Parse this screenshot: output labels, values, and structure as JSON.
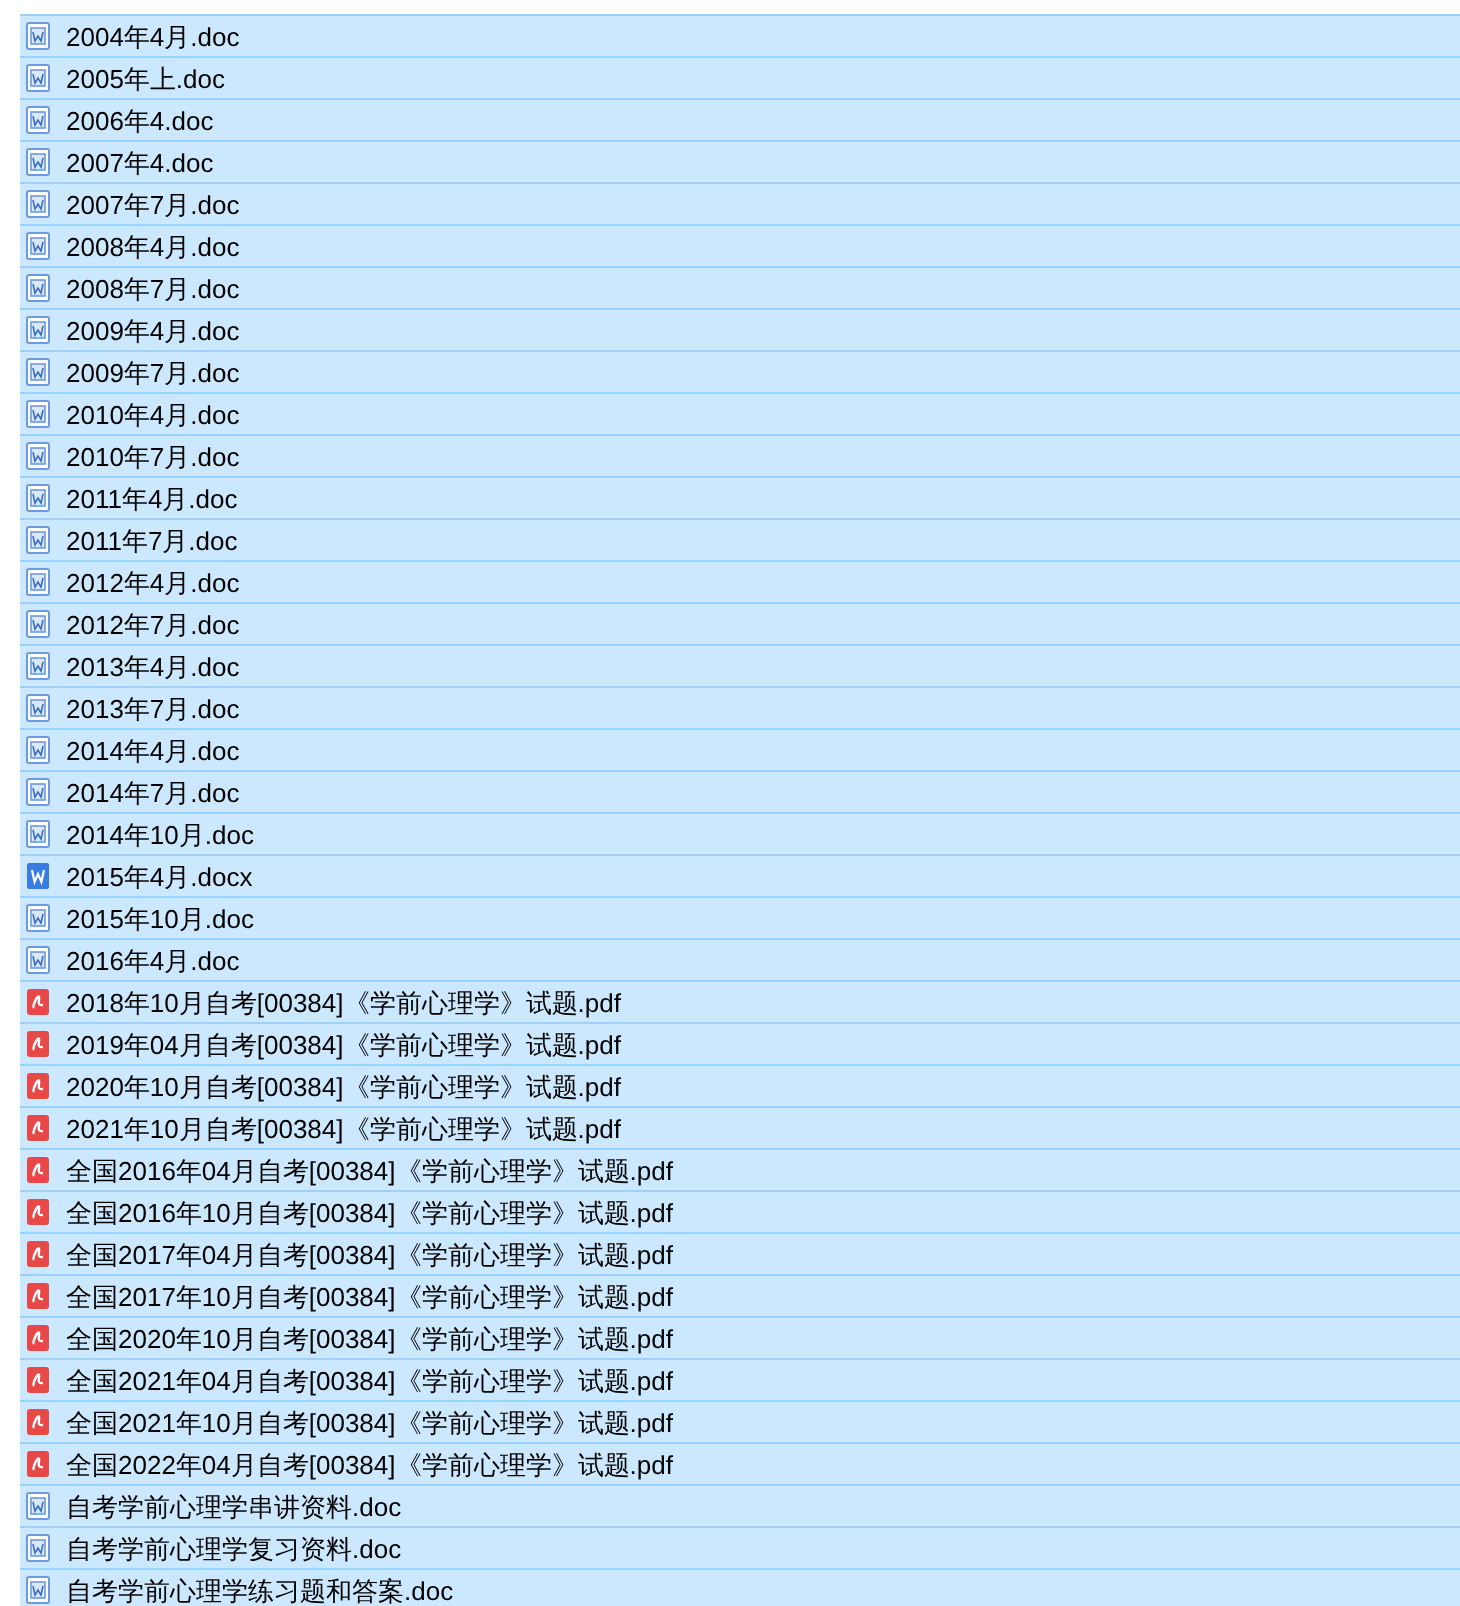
{
  "files": [
    {
      "name": "2004年4月.doc",
      "kind": "doc",
      "selected": true
    },
    {
      "name": "2005年上.doc",
      "kind": "doc",
      "selected": true
    },
    {
      "name": "2006年4.doc",
      "kind": "doc",
      "selected": true
    },
    {
      "name": "2007年4.doc",
      "kind": "doc",
      "selected": true
    },
    {
      "name": "2007年7月.doc",
      "kind": "doc",
      "selected": true
    },
    {
      "name": "2008年4月.doc",
      "kind": "doc",
      "selected": true
    },
    {
      "name": "2008年7月.doc",
      "kind": "doc",
      "selected": true
    },
    {
      "name": "2009年4月.doc",
      "kind": "doc",
      "selected": true
    },
    {
      "name": "2009年7月.doc",
      "kind": "doc",
      "selected": true
    },
    {
      "name": "2010年4月.doc",
      "kind": "doc",
      "selected": true
    },
    {
      "name": "2010年7月.doc",
      "kind": "doc",
      "selected": true
    },
    {
      "name": "2011年4月.doc",
      "kind": "doc",
      "selected": true
    },
    {
      "name": "2011年7月.doc",
      "kind": "doc",
      "selected": true
    },
    {
      "name": "2012年4月.doc",
      "kind": "doc",
      "selected": true
    },
    {
      "name": "2012年7月.doc",
      "kind": "doc",
      "selected": true
    },
    {
      "name": "2013年4月.doc",
      "kind": "doc",
      "selected": true
    },
    {
      "name": "2013年7月.doc",
      "kind": "doc",
      "selected": true
    },
    {
      "name": "2014年4月.doc",
      "kind": "doc",
      "selected": true
    },
    {
      "name": "2014年7月.doc",
      "kind": "doc",
      "selected": true
    },
    {
      "name": "2014年10月.doc",
      "kind": "doc",
      "selected": true
    },
    {
      "name": "2015年4月.docx",
      "kind": "docx",
      "selected": true
    },
    {
      "name": "2015年10月.doc",
      "kind": "doc",
      "selected": true
    },
    {
      "name": "2016年4月.doc",
      "kind": "doc",
      "selected": true
    },
    {
      "name": "2018年10月自考[00384]《学前心理学》试题.pdf",
      "kind": "pdf",
      "selected": true
    },
    {
      "name": "2019年04月自考[00384]《学前心理学》试题.pdf",
      "kind": "pdf",
      "selected": true
    },
    {
      "name": "2020年10月自考[00384]《学前心理学》试题.pdf",
      "kind": "pdf",
      "selected": true
    },
    {
      "name": "2021年10月自考[00384]《学前心理学》试题.pdf",
      "kind": "pdf",
      "selected": true
    },
    {
      "name": "全国2016年04月自考[00384]《学前心理学》试题.pdf",
      "kind": "pdf",
      "selected": true
    },
    {
      "name": "全国2016年10月自考[00384]《学前心理学》试题.pdf",
      "kind": "pdf",
      "selected": true
    },
    {
      "name": "全国2017年04月自考[00384]《学前心理学》试题.pdf",
      "kind": "pdf",
      "selected": true
    },
    {
      "name": "全国2017年10月自考[00384]《学前心理学》试题.pdf",
      "kind": "pdf",
      "selected": true
    },
    {
      "name": "全国2020年10月自考[00384]《学前心理学》试题.pdf",
      "kind": "pdf",
      "selected": true
    },
    {
      "name": "全国2021年04月自考[00384]《学前心理学》试题.pdf",
      "kind": "pdf",
      "selected": true
    },
    {
      "name": "全国2021年10月自考[00384]《学前心理学》试题.pdf",
      "kind": "pdf",
      "selected": true
    },
    {
      "name": "全国2022年04月自考[00384]《学前心理学》试题.pdf",
      "kind": "pdf",
      "selected": true
    },
    {
      "name": "自考学前心理学串讲资料.doc",
      "kind": "doc",
      "selected": true
    },
    {
      "name": "自考学前心理学复习资料.doc",
      "kind": "doc",
      "selected": true
    },
    {
      "name": "自考学前心理学练习题和答案.doc",
      "kind": "doc",
      "selected": true
    }
  ]
}
